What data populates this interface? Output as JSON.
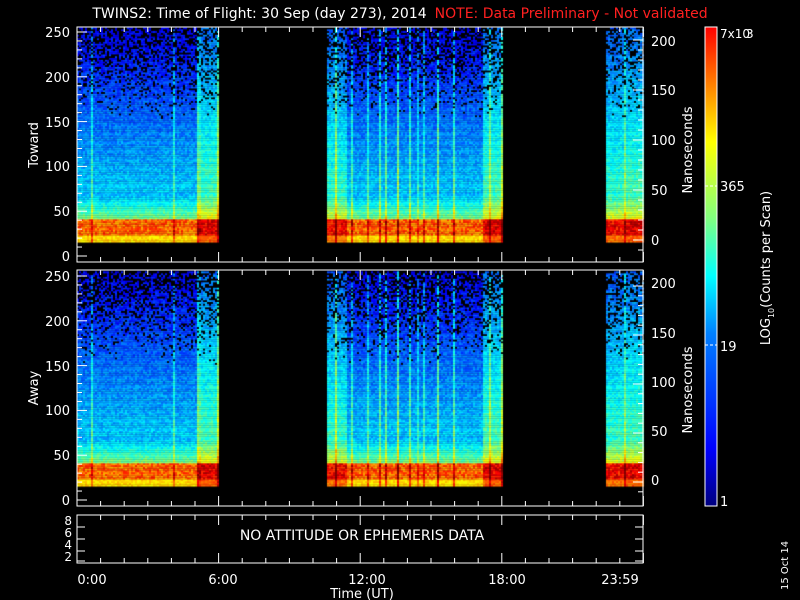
{
  "title": "TWINS2: Time of Flight: 30 Sep (day 273), 2014",
  "note": "NOTE: Data Preliminary - Not validated",
  "date_stamp": "15 Oct 14",
  "chart_data": [
    {
      "type": "heatmap",
      "panel": "Toward",
      "ylabel": "Toward",
      "ylim": [
        -7,
        255
      ],
      "yticks": [
        "0",
        "50",
        "100",
        "150",
        "200",
        "250"
      ],
      "y2label": "Nanoseconds",
      "y2ticks": [
        "0",
        "50",
        "100",
        "150",
        "200"
      ],
      "xlim_hours": [
        0,
        24
      ],
      "data_intervals_hours": [
        [
          0,
          6.0
        ],
        [
          10.6,
          18.0
        ],
        [
          22.4,
          23.99
        ]
      ],
      "peak_bin_range": [
        15,
        40
      ]
    },
    {
      "type": "heatmap",
      "panel": "Away",
      "ylabel": "Away",
      "ylim": [
        -7,
        255
      ],
      "yticks": [
        "0",
        "50",
        "100",
        "150",
        "200",
        "250"
      ],
      "y2label": "Nanoseconds",
      "y2ticks": [
        "0",
        "50",
        "100",
        "150",
        "200"
      ],
      "xlim_hours": [
        0,
        24
      ],
      "data_intervals_hours": [
        [
          0,
          6.0
        ],
        [
          10.6,
          18.0
        ],
        [
          22.4,
          23.99
        ]
      ],
      "peak_bin_range": [
        15,
        40
      ]
    },
    {
      "type": "line",
      "panel": "attitude",
      "yticks": [
        "2",
        "4",
        "6",
        "8"
      ],
      "message": "NO ATTITUDE OR EPHEMERIS DATA"
    }
  ],
  "xaxis": {
    "label": "Time (UT)",
    "ticks": [
      "0:00",
      "6:00",
      "12:00",
      "18:00",
      "23:59"
    ],
    "tick_hours": [
      0,
      6,
      12,
      18,
      23.98
    ]
  },
  "colorbar": {
    "label": "LOG10(Counts per Scan)",
    "label_main": "LOG",
    "label_sub": "10",
    "label_rest": "(Counts per Scan)",
    "max_label": "7x10",
    "max_sub": "10",
    "max_exp": "3",
    "min_value": 1,
    "max_value": 7000,
    "ticks": [
      {
        "value": 19,
        "label": "19"
      },
      {
        "value": 365,
        "label": "365"
      }
    ],
    "min_label": "1",
    "scale": "log"
  }
}
